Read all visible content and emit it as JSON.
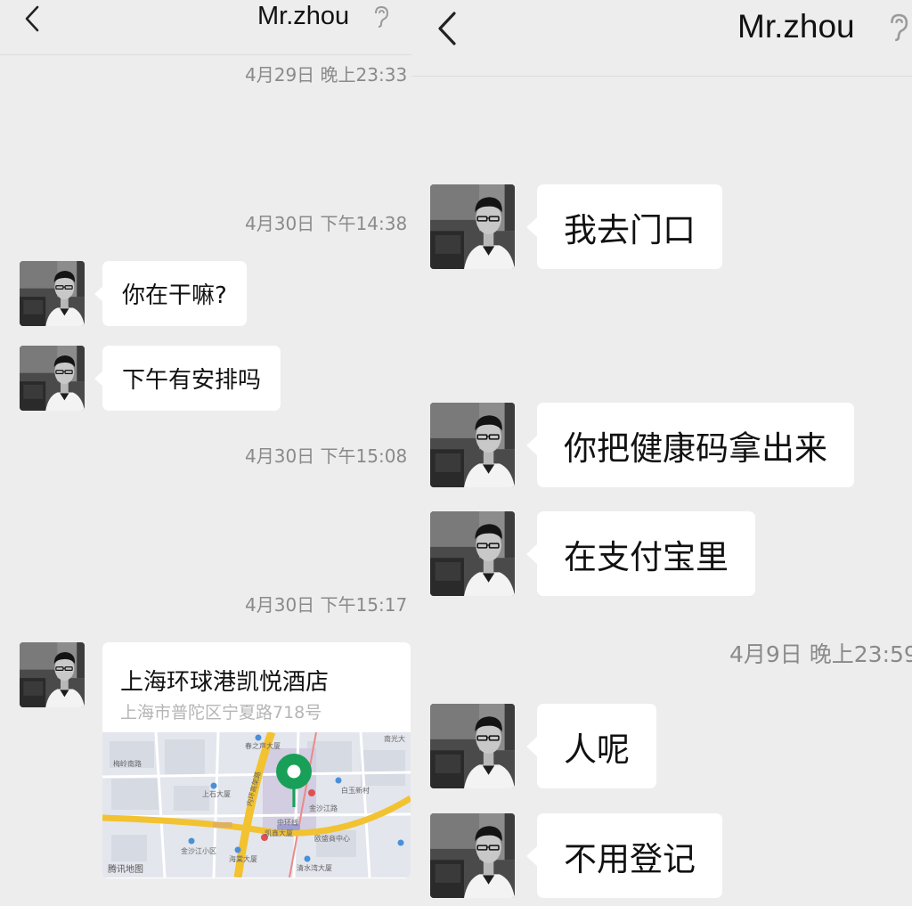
{
  "left": {
    "header": {
      "title": "Mr.zhou"
    },
    "messages": [
      {
        "time": "4月29日 晚上23:33"
      },
      {
        "time": "4月30日 下午14:38"
      },
      {
        "text": "你在干嘛?"
      },
      {
        "text": "下午有安排吗"
      },
      {
        "time": "4月30日 下午15:08"
      },
      {
        "time": "4月30日 下午15:17"
      }
    ],
    "location": {
      "name": "上海环球港凯悦酒店",
      "address": "上海市普陀区宁夏路718号",
      "map_credit": "腾讯地图",
      "map_labels": [
        "春之声大厦",
        "上石大厦",
        "白玉新村",
        "金沙江路",
        "金沙江小区",
        "海棠大厦",
        "凯鑫大厦",
        "欧盛商中心",
        "清水湾大厦",
        "南光大",
        "梅岭南路",
        "中环线",
        "内环高架路"
      ]
    }
  },
  "right": {
    "header": {
      "title": "Mr.zhou"
    },
    "messages": [
      {
        "text": "我去门口"
      },
      {
        "text": "你把健康码拿出来"
      },
      {
        "text": "在支付宝里"
      },
      {
        "time": "4月9日 晚上23:59"
      },
      {
        "text": "人呢"
      },
      {
        "text": "不用登记"
      }
    ]
  },
  "colors": {
    "background": "#ededed",
    "bubble": "#ffffff",
    "timestamp": "#8a8a8a",
    "map_pin": "#18a058",
    "highway": "#f2c230"
  },
  "icons": {
    "back": "chevron-left-icon",
    "voice": "ear-icon",
    "pin": "map-pin-icon"
  }
}
